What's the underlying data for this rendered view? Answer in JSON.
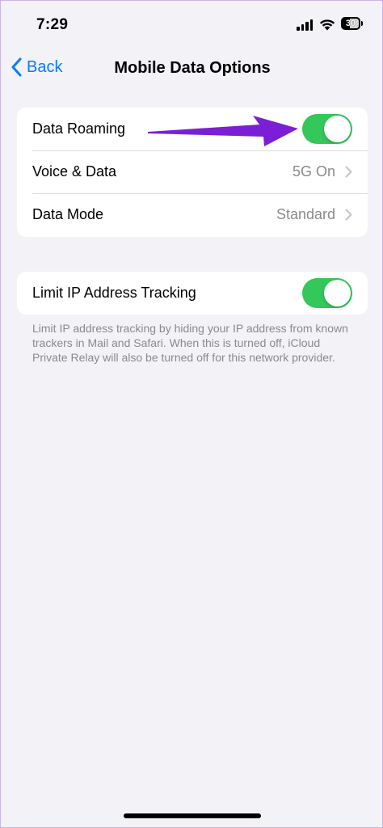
{
  "status_bar": {
    "time": "7:29",
    "battery_percent": "30"
  },
  "nav": {
    "back_label": "Back",
    "title": "Mobile Data Options"
  },
  "group1": {
    "rows": [
      {
        "label": "Data Roaming",
        "toggle_on": true
      },
      {
        "label": "Voice & Data",
        "value": "5G On"
      },
      {
        "label": "Data Mode",
        "value": "Standard"
      }
    ]
  },
  "group2": {
    "rows": [
      {
        "label": "Limit IP Address Tracking",
        "toggle_on": true
      }
    ],
    "footer": "Limit IP address tracking by hiding your IP address from known trackers in Mail and Safari. When this is turned off, iCloud Private Relay will also be turned off for this network provider."
  },
  "colors": {
    "accent": "#0a7aff",
    "toggle_on": "#34c759",
    "annotation_arrow": "#7a1fd6",
    "background": "#f2f2f7"
  }
}
